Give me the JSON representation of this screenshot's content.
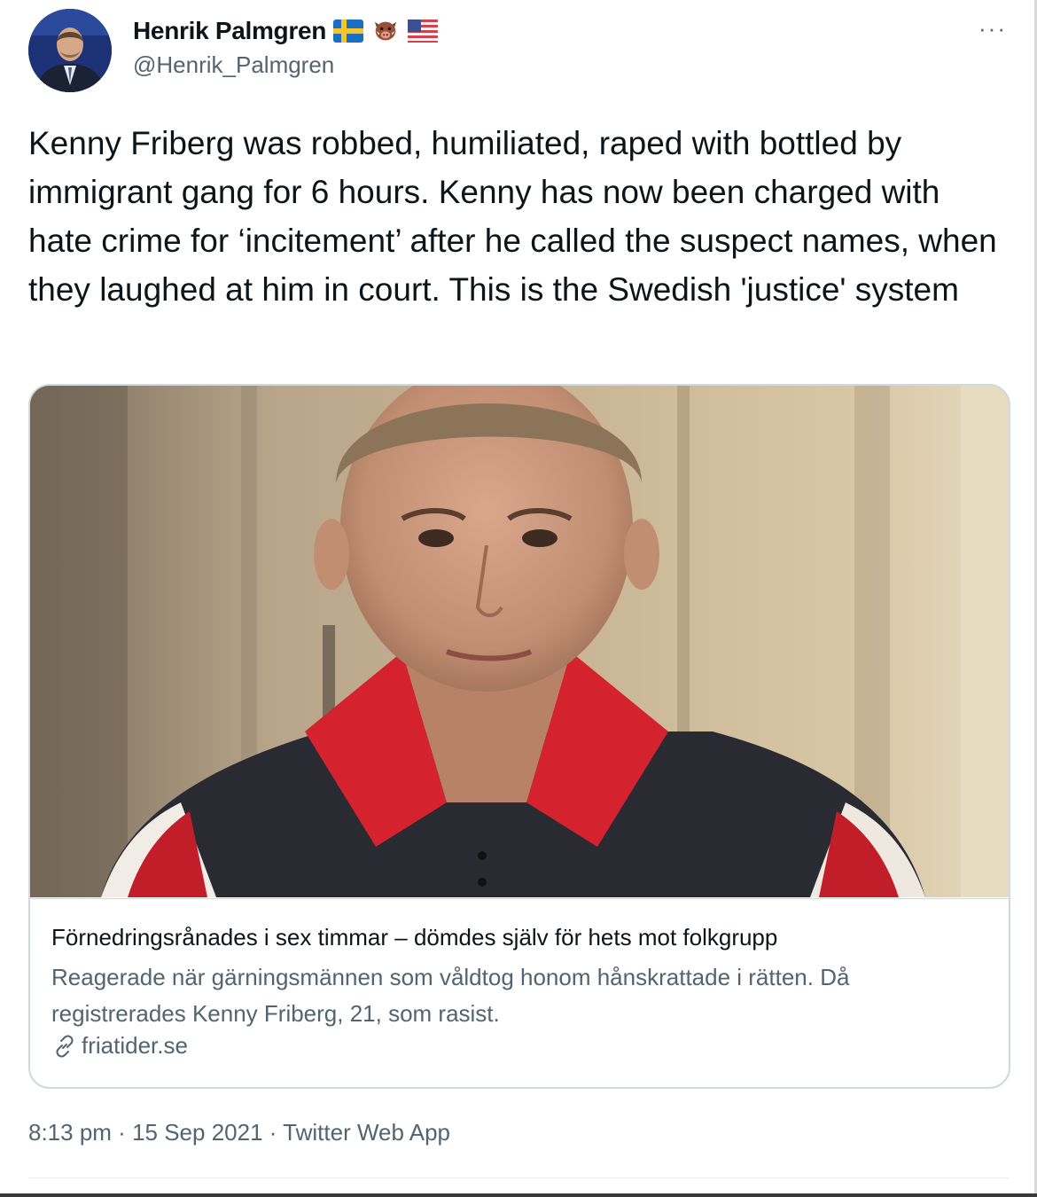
{
  "author": {
    "display_name": "Henrik Palmgren",
    "handle": "@Henrik_Palmgren",
    "badges": [
      "sweden-flag-icon",
      "boar-icon",
      "usa-flag-icon"
    ]
  },
  "tweet": {
    "text": "Kenny Friberg was robbed, humiliated, raped with bottled by  immigrant gang for 6 hours. Kenny has now been charged with hate crime for ‘incitement’ after he called the suspect names, when they laughed at him in court. This is the Swedish 'justice' system"
  },
  "card": {
    "title": "Förnedringsrånades i sex timmar – dömdes själv för hets mot folkgrupp",
    "description": "Reagerade när gärningsmännen som våldtog honom hånskrattade i rätten. Då registrerades Kenny Friberg, 21, som rasist.",
    "domain": "friatider.se"
  },
  "meta": {
    "time": "8:13 pm",
    "separator": " · ",
    "date": "15 Sep 2021",
    "source": "Twitter Web App"
  },
  "more_label": "···",
  "colors": {
    "text_primary": "#0f1419",
    "text_secondary": "#536471",
    "border": "#cfd9de"
  }
}
